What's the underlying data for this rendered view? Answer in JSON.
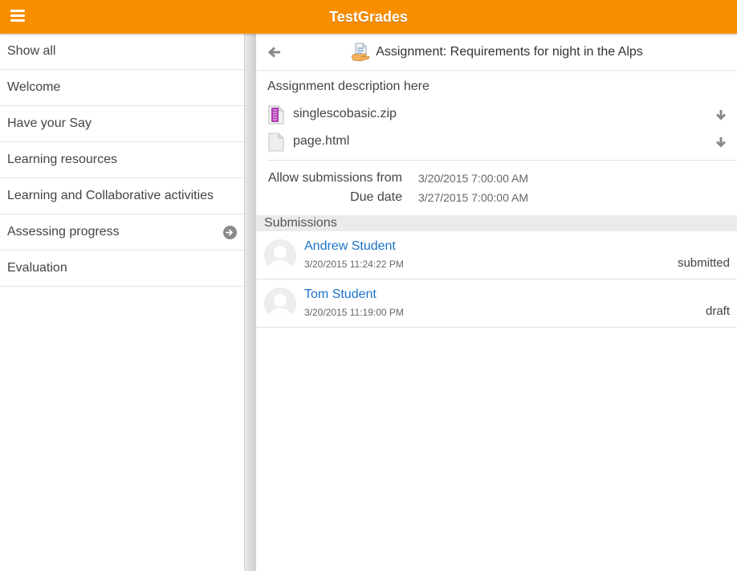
{
  "app": {
    "title": "TestGrades",
    "accent_color": "#f98e00"
  },
  "sidebar": {
    "items": [
      {
        "label": "Show all"
      },
      {
        "label": "Welcome"
      },
      {
        "label": "Have your Say"
      },
      {
        "label": "Learning resources"
      },
      {
        "label": "Learning and Collaborative activities"
      },
      {
        "label": "Assessing progress",
        "icon": "arrow-right-circle-icon"
      },
      {
        "label": "Evaluation"
      }
    ]
  },
  "content": {
    "title": "Assignment: Requirements for night in the Alps",
    "description": "Assignment description here",
    "files": [
      {
        "name": "singlescobasic.zip",
        "icon": "zip-file-icon"
      },
      {
        "name": "page.html",
        "icon": "document-file-icon"
      }
    ],
    "dates": {
      "allow_label": "Allow submissions from",
      "allow_value": "3/20/2015 7:00:00 AM",
      "due_label": "Due date",
      "due_value": "3/27/2015 7:00:00 AM"
    },
    "submissions_header": "Submissions",
    "submissions": [
      {
        "name": "Andrew Student",
        "date": "3/20/2015 11:24:22 PM",
        "status": "submitted"
      },
      {
        "name": "Tom Student",
        "date": "3/20/2015 11:19:00 PM",
        "status": "draft"
      }
    ]
  }
}
